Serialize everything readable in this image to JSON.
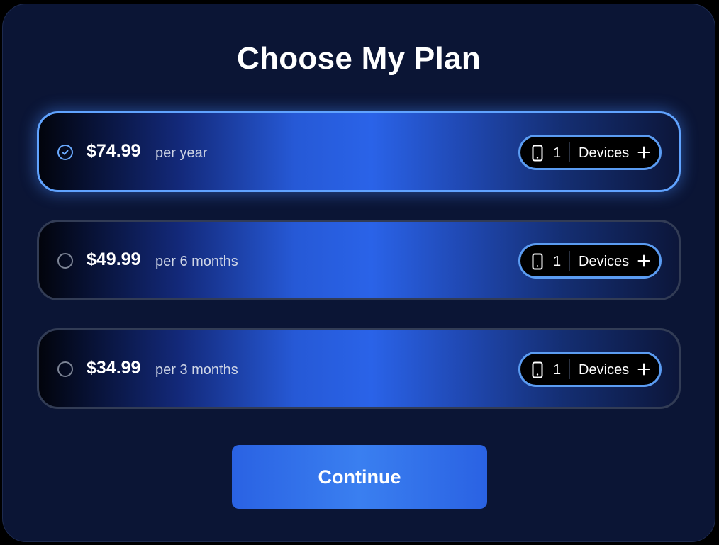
{
  "title": "Choose My Plan",
  "plans": [
    {
      "price": "$74.99",
      "period": "per year",
      "devices_count": "1",
      "devices_label": "Devices",
      "selected": true
    },
    {
      "price": "$49.99",
      "period": "per 6 months",
      "devices_count": "1",
      "devices_label": "Devices",
      "selected": false
    },
    {
      "price": "$34.99",
      "period": "per 3 months",
      "devices_count": "1",
      "devices_label": "Devices",
      "selected": false
    }
  ],
  "continue_label": "Continue",
  "icons": {
    "selected": "check-circle-icon",
    "unselected": "radio-empty-icon",
    "device": "phone-icon",
    "add": "plus-icon"
  },
  "colors": {
    "background": "#0b1535",
    "accent": "#60a3ff",
    "button": "#3a7ff0"
  }
}
